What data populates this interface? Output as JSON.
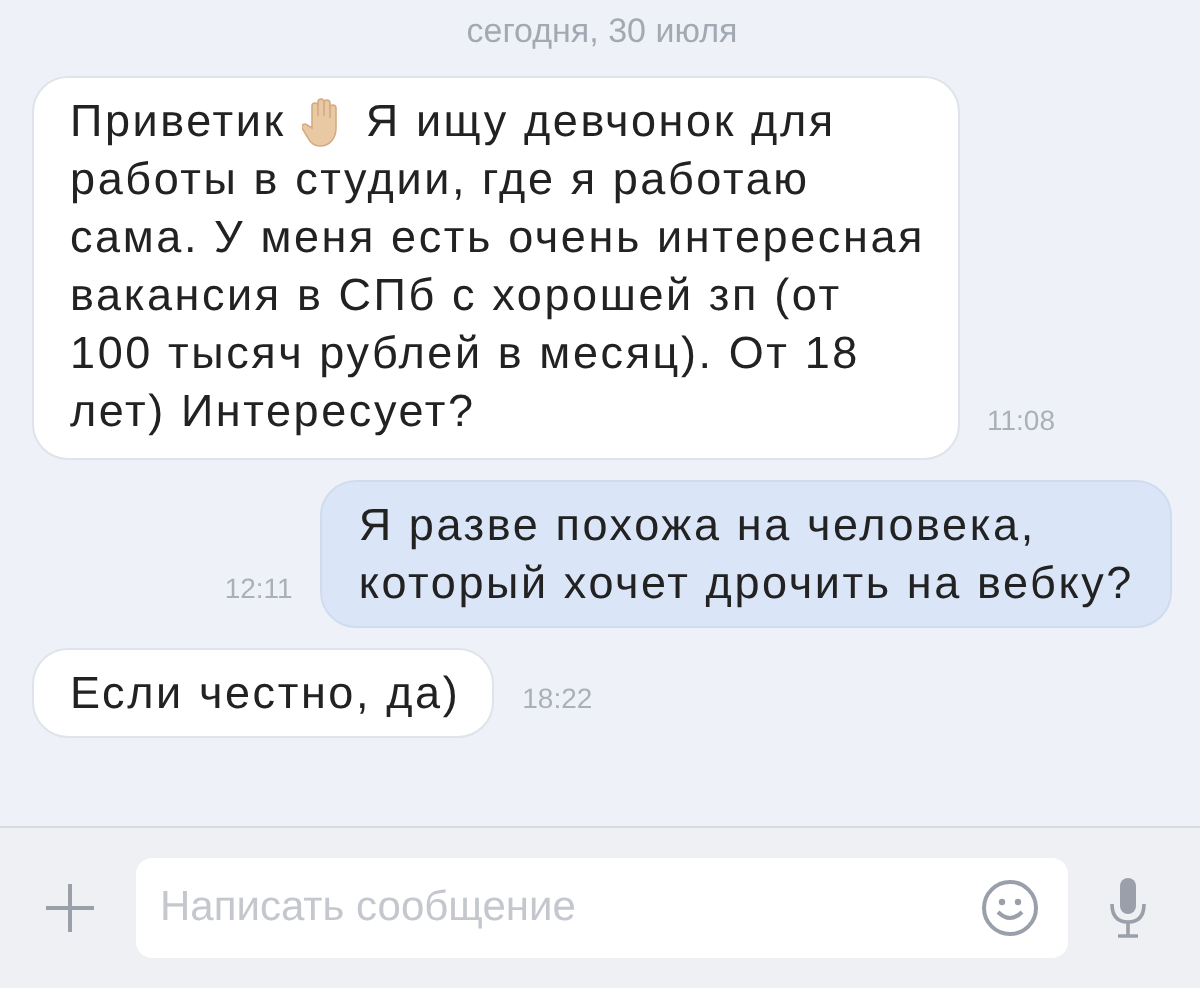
{
  "date_label": "сегодня, 30 июля",
  "messages": [
    {
      "kind": "incoming",
      "lead": "Приветик",
      "has_emoji": true,
      "lines": [
        "Я ищу девчонок для",
        "работы в студии, где я работаю",
        "сама. У меня есть очень интересная",
        "вакансия в СПб с хорошей зп (от",
        "100 тысяч рублей в месяц). От 18",
        "лет) Интересует?"
      ],
      "time": "11:08"
    },
    {
      "kind": "outgoing",
      "lines": [
        "Я разве похожа на человека,",
        "который хочет дрочить на вебку?"
      ],
      "time": "12:11"
    },
    {
      "kind": "incoming",
      "lines": [
        "Если честно, да)"
      ],
      "time": "18:22"
    }
  ],
  "composer": {
    "placeholder": "Написать сообщение"
  }
}
